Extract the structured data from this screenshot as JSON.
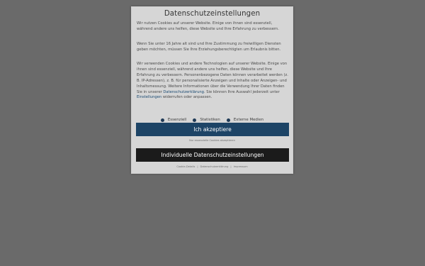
{
  "modal": {
    "title": "Datenschutzeinstellungen",
    "paragraph1": "Wir nutzen Cookies auf unserer Website. Einige von ihnen sind essenziell, während andere uns helfen, diese Website und Ihre Erfahrung zu verbessern.",
    "paragraph2": "Wenn Sie unter 16 Jahre alt sind und Ihre Zustimmung zu freiwilligen Diensten geben möchten, müssen Sie Ihre Erziehungsberechtigten um Erlaubnis bitten.",
    "paragraph3_a": "Wir verwenden Cookies und andere Technologien auf unserer Website. Einige von ihnen sind essenziell, während andere uns helfen, diese Website und Ihre Erfahrung zu verbessern. Personenbezogene Daten können verarbeitet werden (z. B. IP-Adressen), z. B. für personalisierte Anzeigen und Inhalte oder Anzeigen- und Inhaltsmessung. Weitere Informationen über die Verwendung Ihrer Daten finden Sie in unserer ",
    "paragraph3_link1": "Datenschutzerklärung",
    "paragraph3_b": ". Sie können Ihre Auswahl jederzeit unter ",
    "paragraph3_link2": "Einstellungen",
    "paragraph3_c": " widerrufen oder anpassen.",
    "toggles": [
      {
        "label": "Essenziell"
      },
      {
        "label": "Statistiken"
      },
      {
        "label": "Externe Medien"
      }
    ],
    "accept_button": "Ich akzeptiere",
    "essential_only_link": "Nur essenzielle Cookies akzeptieren",
    "individual_button": "Individuelle Datenschutzeinstellungen",
    "footer_links": [
      "Cookie-Details",
      "Datenschutzerklärung",
      "Impressum"
    ]
  },
  "colors": {
    "accent": "#1d4466",
    "dark_button": "#1b1b1b",
    "overlay": "#6a6a6a",
    "panel": "#d6d6d6"
  }
}
